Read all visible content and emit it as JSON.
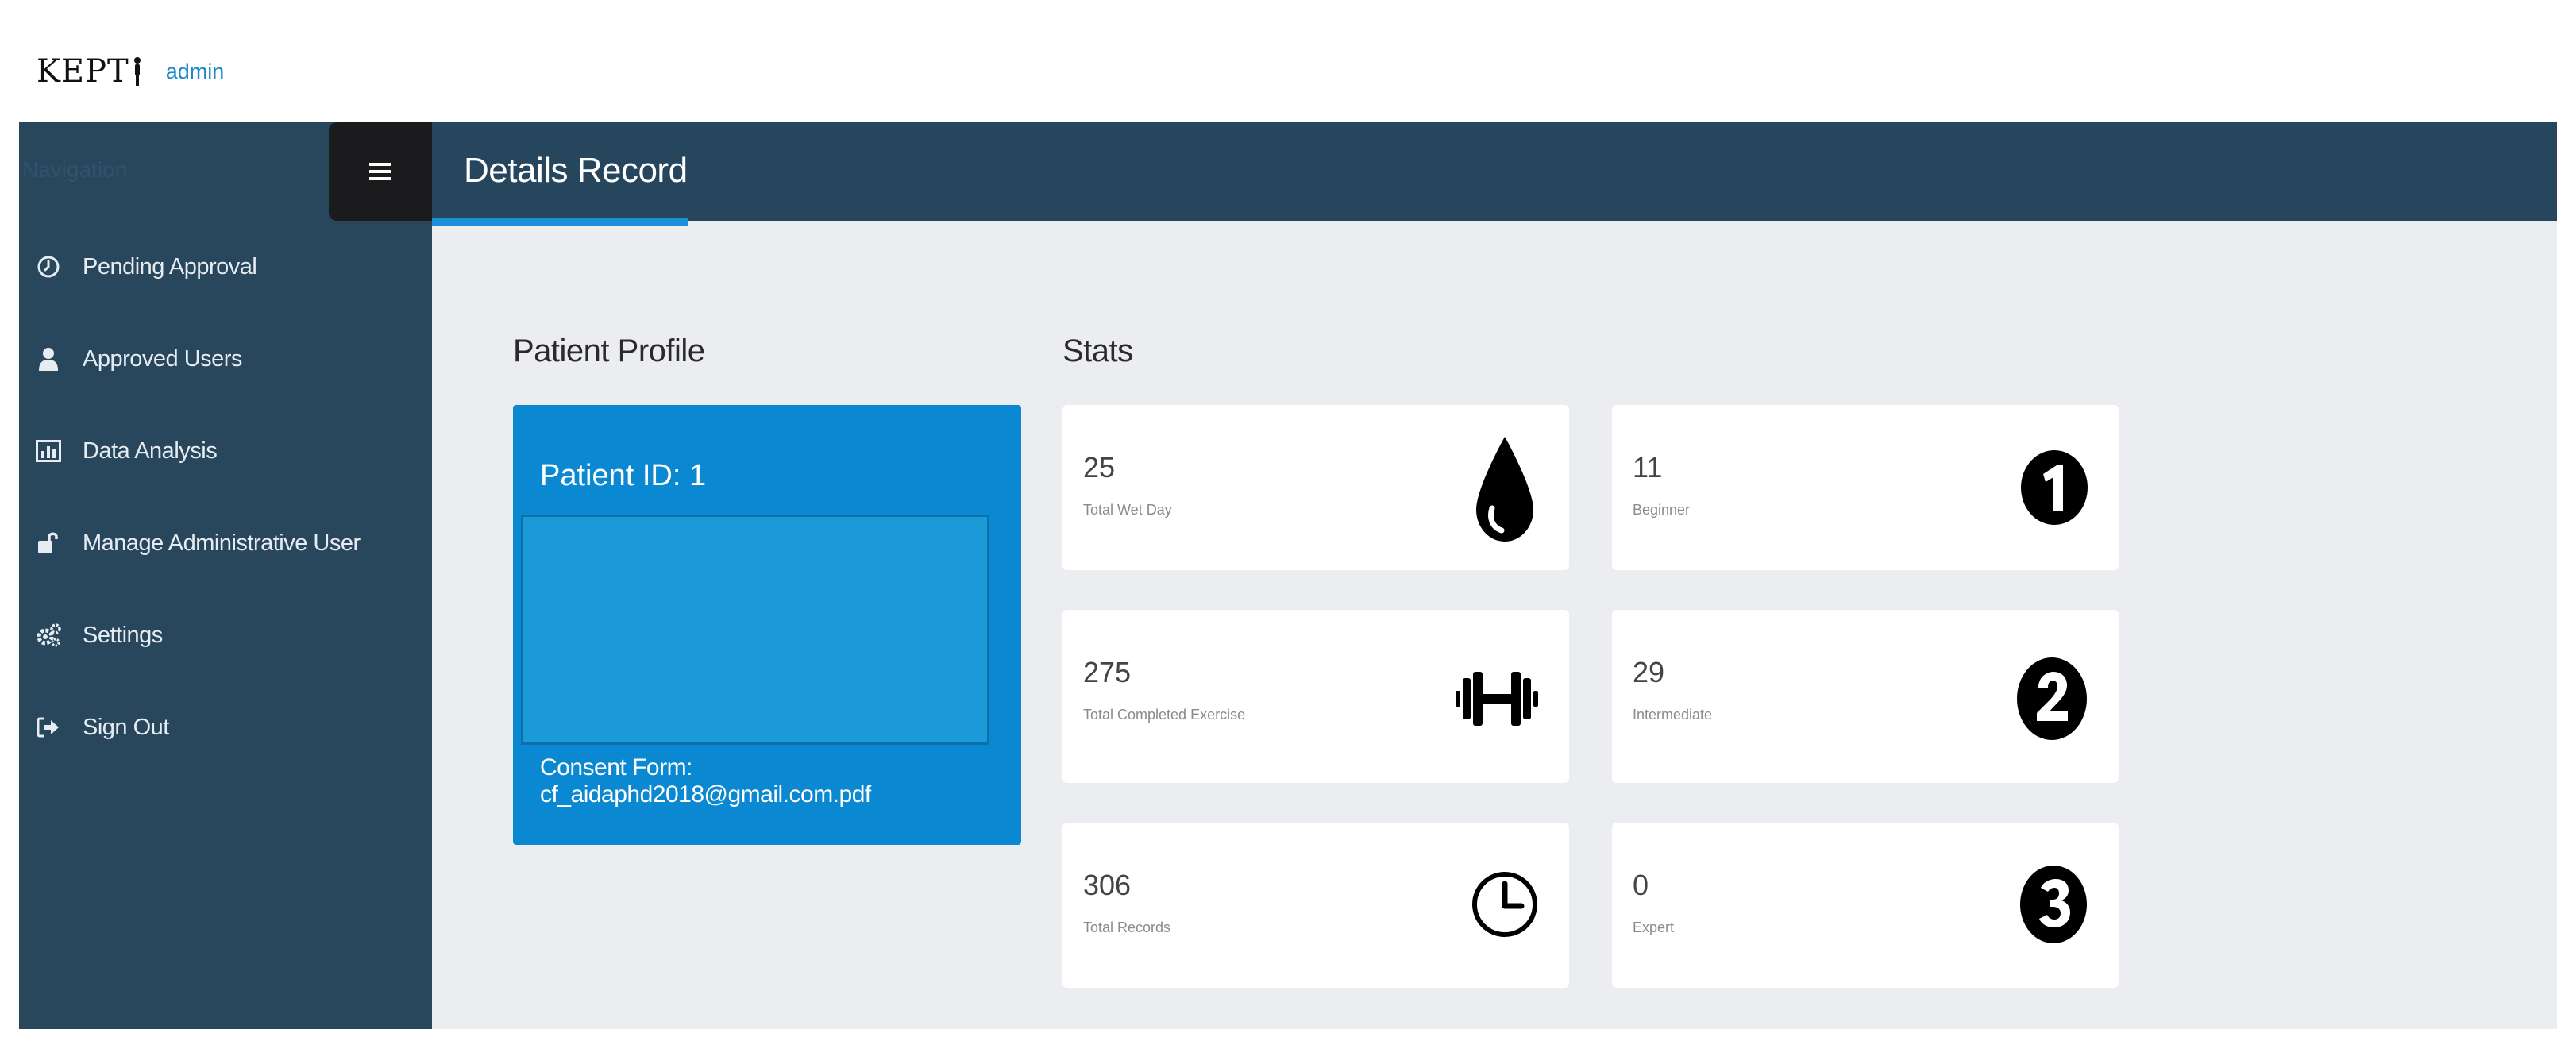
{
  "app": {
    "logo_text": "KEPT",
    "user": "admin"
  },
  "sidebar": {
    "nav_label": "Navigation",
    "items": [
      {
        "label": "Pending Approval",
        "icon": "clock-icon"
      },
      {
        "label": "Approved Users",
        "icon": "user-icon"
      },
      {
        "label": "Data Analysis",
        "icon": "bar-chart-icon"
      },
      {
        "label": "Manage Administrative User",
        "icon": "unlock-icon"
      },
      {
        "label": "Settings",
        "icon": "gears-icon"
      },
      {
        "label": "Sign Out",
        "icon": "sign-out-icon"
      }
    ]
  },
  "header": {
    "title": "Details Record"
  },
  "profile": {
    "section_title": "Patient Profile",
    "patient_id": "Patient ID: 1",
    "consent_form": "Consent Form: cf_aidaphd2018@gmail.com.pdf"
  },
  "stats": {
    "section_title": "Stats",
    "cards": [
      {
        "value": "25",
        "label": "Total Wet Day",
        "icon": "water-drop-icon"
      },
      {
        "value": "11",
        "label": "Beginner",
        "icon": "number-one-icon"
      },
      {
        "value": "275",
        "label": "Total Completed Exercise",
        "icon": "dumbbell-icon"
      },
      {
        "value": "29",
        "label": "Intermediate",
        "icon": "number-two-icon"
      },
      {
        "value": "306",
        "label": "Total Records",
        "icon": "clock-icon"
      },
      {
        "value": "0",
        "label": "Expert",
        "icon": "number-three-icon"
      }
    ]
  },
  "colors": {
    "sidebar_bg": "#28465c",
    "header_bg": "#26465d",
    "accent_blue": "#0a88d1",
    "content_bg": "#ebedf0"
  }
}
